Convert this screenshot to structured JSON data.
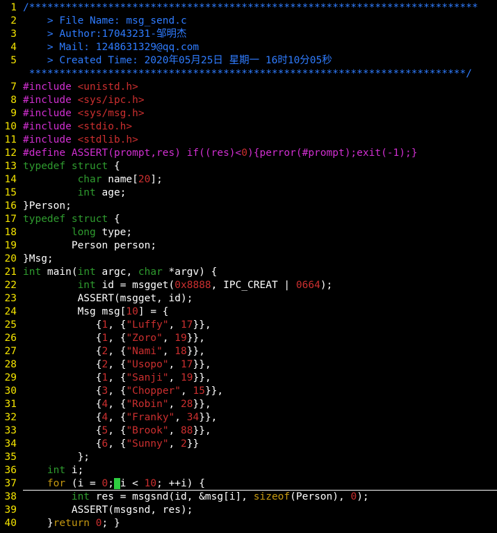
{
  "editor": {
    "colors": {
      "background": "#000000",
      "line_number": "#f5e500",
      "comment": "#2f7cff",
      "preprocessor": "#d12fd1",
      "constant": "#cc2f2f",
      "type": "#2f9c2f",
      "keyword": "#c79a10",
      "text": "#ffffff",
      "cursor": "#2ecc40"
    },
    "cursor_line": 37,
    "lines": [
      {
        "n": "1",
        "t": [
          [
            "comment",
            "/**************************************************************************"
          ]
        ]
      },
      {
        "n": "2",
        "t": [
          [
            "comment",
            "    > File Name: msg_send.c"
          ]
        ]
      },
      {
        "n": "3",
        "t": [
          [
            "comment",
            "    > Author:17043231-邹明杰"
          ]
        ]
      },
      {
        "n": "4",
        "t": [
          [
            "comment",
            "    > Mail: 1248631329@qq.com"
          ]
        ]
      },
      {
        "n": "5",
        "t": [
          [
            "comment",
            "    > Created Time: 2020年05月25日 星期一 16时10分05秒"
          ]
        ]
      },
      {
        "n": "",
        "t": [
          [
            "comment",
            " ************************************************************************/"
          ]
        ]
      },
      {
        "n": "7",
        "t": [
          [
            "pre",
            "#include "
          ],
          [
            "str",
            "<unistd.h>"
          ]
        ]
      },
      {
        "n": "8",
        "t": [
          [
            "pre",
            "#include "
          ],
          [
            "str",
            "<sys/ipc.h>"
          ]
        ]
      },
      {
        "n": "9",
        "t": [
          [
            "pre",
            "#include "
          ],
          [
            "str",
            "<sys/msg.h>"
          ]
        ]
      },
      {
        "n": "10",
        "t": [
          [
            "pre",
            "#include "
          ],
          [
            "str",
            "<stdio.h>"
          ]
        ]
      },
      {
        "n": "11",
        "t": [
          [
            "pre",
            "#include "
          ],
          [
            "str",
            "<stdlib.h>"
          ]
        ]
      },
      {
        "n": "12",
        "t": [
          [
            "pre",
            "#define ASSERT(prompt,res) if((res)<"
          ],
          [
            "num",
            "0"
          ],
          [
            "pre",
            "){perror(#prompt);exit(-1);}"
          ]
        ]
      },
      {
        "n": "13",
        "t": [
          [
            "type",
            "typedef"
          ],
          [
            "plain",
            " "
          ],
          [
            "type",
            "struct"
          ],
          [
            "plain",
            " {"
          ]
        ]
      },
      {
        "n": "14",
        "t": [
          [
            "plain",
            "         "
          ],
          [
            "type",
            "char"
          ],
          [
            "plain",
            " name["
          ],
          [
            "num",
            "20"
          ],
          [
            "plain",
            "];"
          ]
        ]
      },
      {
        "n": "15",
        "t": [
          [
            "plain",
            "         "
          ],
          [
            "type",
            "int"
          ],
          [
            "plain",
            " age;"
          ]
        ]
      },
      {
        "n": "16",
        "t": [
          [
            "plain",
            "}Person;"
          ]
        ]
      },
      {
        "n": "17",
        "t": [
          [
            "type",
            "typedef"
          ],
          [
            "plain",
            " "
          ],
          [
            "type",
            "struct"
          ],
          [
            "plain",
            " {"
          ]
        ]
      },
      {
        "n": "18",
        "t": [
          [
            "plain",
            "        "
          ],
          [
            "type",
            "long"
          ],
          [
            "plain",
            " type;"
          ]
        ]
      },
      {
        "n": "19",
        "t": [
          [
            "plain",
            "        Person person;"
          ]
        ]
      },
      {
        "n": "20",
        "t": [
          [
            "plain",
            "}Msg;"
          ]
        ]
      },
      {
        "n": "21",
        "t": [
          [
            "type",
            "int"
          ],
          [
            "plain",
            " main("
          ],
          [
            "type",
            "int"
          ],
          [
            "plain",
            " argc, "
          ],
          [
            "type",
            "char"
          ],
          [
            "plain",
            " *argv) {"
          ]
        ]
      },
      {
        "n": "22",
        "t": [
          [
            "plain",
            "         "
          ],
          [
            "type",
            "int"
          ],
          [
            "plain",
            " id = msgget("
          ],
          [
            "num",
            "0x8888"
          ],
          [
            "plain",
            ", IPC_CREAT | "
          ],
          [
            "num",
            "0664"
          ],
          [
            "plain",
            ");"
          ]
        ]
      },
      {
        "n": "23",
        "t": [
          [
            "plain",
            "         ASSERT(msgget, id);"
          ]
        ]
      },
      {
        "n": "24",
        "t": [
          [
            "plain",
            "         Msg msg["
          ],
          [
            "num",
            "10"
          ],
          [
            "plain",
            "] = {"
          ]
        ]
      },
      {
        "n": "25",
        "t": [
          [
            "plain",
            "            {"
          ],
          [
            "num",
            "1"
          ],
          [
            "plain",
            ", {"
          ],
          [
            "str",
            "\"Luffy\""
          ],
          [
            "plain",
            ", "
          ],
          [
            "num",
            "17"
          ],
          [
            "plain",
            "}},"
          ]
        ]
      },
      {
        "n": "26",
        "t": [
          [
            "plain",
            "            {"
          ],
          [
            "num",
            "1"
          ],
          [
            "plain",
            ", {"
          ],
          [
            "str",
            "\"Zoro\""
          ],
          [
            "plain",
            ", "
          ],
          [
            "num",
            "19"
          ],
          [
            "plain",
            "}},"
          ]
        ]
      },
      {
        "n": "27",
        "t": [
          [
            "plain",
            "            {"
          ],
          [
            "num",
            "2"
          ],
          [
            "plain",
            ", {"
          ],
          [
            "str",
            "\"Nami\""
          ],
          [
            "plain",
            ", "
          ],
          [
            "num",
            "18"
          ],
          [
            "plain",
            "}},"
          ]
        ]
      },
      {
        "n": "28",
        "t": [
          [
            "plain",
            "            {"
          ],
          [
            "num",
            "2"
          ],
          [
            "plain",
            ", {"
          ],
          [
            "str",
            "\"Usopo\""
          ],
          [
            "plain",
            ", "
          ],
          [
            "num",
            "17"
          ],
          [
            "plain",
            "}},"
          ]
        ]
      },
      {
        "n": "29",
        "t": [
          [
            "plain",
            "            {"
          ],
          [
            "num",
            "1"
          ],
          [
            "plain",
            ", {"
          ],
          [
            "str",
            "\"Sanji\""
          ],
          [
            "plain",
            ", "
          ],
          [
            "num",
            "19"
          ],
          [
            "plain",
            "}},"
          ]
        ]
      },
      {
        "n": "30",
        "t": [
          [
            "plain",
            "            {"
          ],
          [
            "num",
            "3"
          ],
          [
            "plain",
            ", {"
          ],
          [
            "str",
            "\"Chopper\""
          ],
          [
            "plain",
            ", "
          ],
          [
            "num",
            "15"
          ],
          [
            "plain",
            "}},"
          ]
        ]
      },
      {
        "n": "31",
        "t": [
          [
            "plain",
            "            {"
          ],
          [
            "num",
            "4"
          ],
          [
            "plain",
            ", {"
          ],
          [
            "str",
            "\"Robin\""
          ],
          [
            "plain",
            ", "
          ],
          [
            "num",
            "28"
          ],
          [
            "plain",
            "}},"
          ]
        ]
      },
      {
        "n": "32",
        "t": [
          [
            "plain",
            "            {"
          ],
          [
            "num",
            "4"
          ],
          [
            "plain",
            ", {"
          ],
          [
            "str",
            "\"Franky\""
          ],
          [
            "plain",
            ", "
          ],
          [
            "num",
            "34"
          ],
          [
            "plain",
            "}},"
          ]
        ]
      },
      {
        "n": "33",
        "t": [
          [
            "plain",
            "            {"
          ],
          [
            "num",
            "5"
          ],
          [
            "plain",
            ", {"
          ],
          [
            "str",
            "\"Brook\""
          ],
          [
            "plain",
            ", "
          ],
          [
            "num",
            "88"
          ],
          [
            "plain",
            "}},"
          ]
        ]
      },
      {
        "n": "34",
        "t": [
          [
            "plain",
            "            {"
          ],
          [
            "num",
            "6"
          ],
          [
            "plain",
            ", {"
          ],
          [
            "str",
            "\"Sunny\""
          ],
          [
            "plain",
            ", "
          ],
          [
            "num",
            "2"
          ],
          [
            "plain",
            "}}"
          ]
        ]
      },
      {
        "n": "35",
        "t": [
          [
            "plain",
            "         };"
          ]
        ]
      },
      {
        "n": "36",
        "t": [
          [
            "plain",
            "    "
          ],
          [
            "type",
            "int"
          ],
          [
            "plain",
            " i;"
          ]
        ]
      },
      {
        "n": "37",
        "t": [
          [
            "plain",
            "    "
          ],
          [
            "kw",
            "for"
          ],
          [
            "plain",
            " (i = "
          ],
          [
            "num",
            "0"
          ],
          [
            "plain",
            ";"
          ],
          [
            "cursor",
            " "
          ],
          [
            "plain",
            "i < "
          ],
          [
            "num",
            "10"
          ],
          [
            "plain",
            "; ++i) {"
          ]
        ]
      },
      {
        "n": "38",
        "t": [
          [
            "plain",
            "        "
          ],
          [
            "type",
            "int"
          ],
          [
            "plain",
            " res = msgsnd(id, &msg[i], "
          ],
          [
            "kw",
            "sizeof"
          ],
          [
            "plain",
            "(Person), "
          ],
          [
            "num",
            "0"
          ],
          [
            "plain",
            ");"
          ]
        ]
      },
      {
        "n": "39",
        "t": [
          [
            "plain",
            "        ASSERT(msgsnd, res);"
          ]
        ]
      },
      {
        "n": "40",
        "t": [
          [
            "plain",
            "    }"
          ],
          [
            "kw",
            "return"
          ],
          [
            "plain",
            " "
          ],
          [
            "num",
            "0"
          ],
          [
            "plain",
            "; }"
          ]
        ]
      }
    ]
  }
}
